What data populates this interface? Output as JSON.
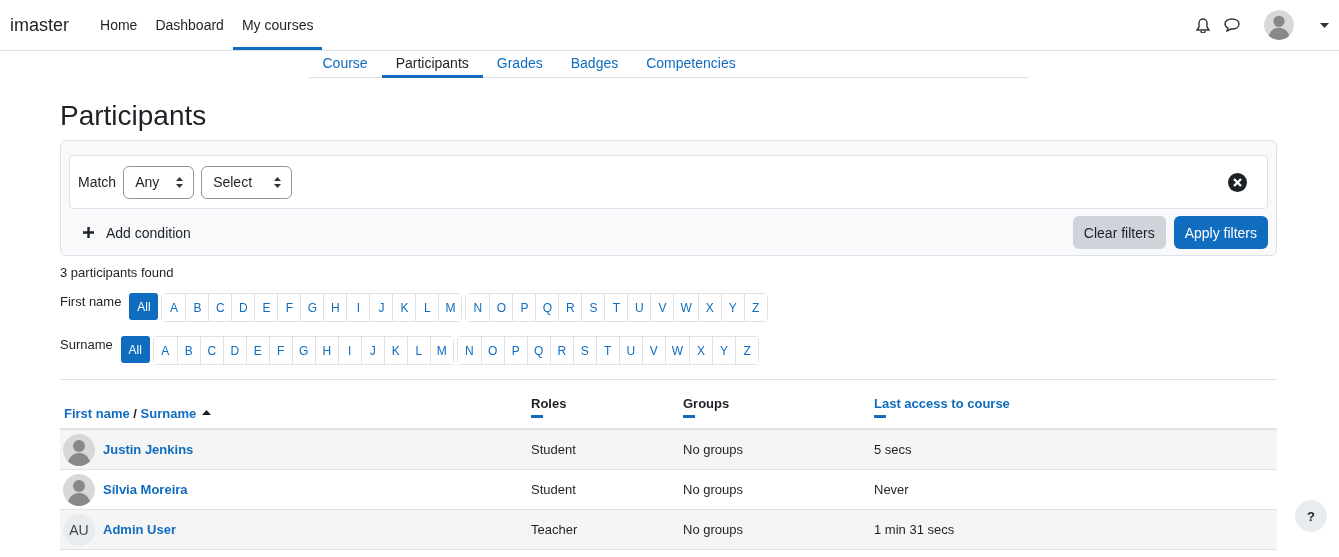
{
  "navbar": {
    "brand": "imaster",
    "links": [
      {
        "label": "Home",
        "selected": false
      },
      {
        "label": "Dashboard",
        "selected": false
      },
      {
        "label": "My courses",
        "selected": true
      }
    ]
  },
  "course_tabs": [
    {
      "label": "Course",
      "selected": false
    },
    {
      "label": "Participants",
      "selected": true
    },
    {
      "label": "Grades",
      "selected": false
    },
    {
      "label": "Badges",
      "selected": false
    },
    {
      "label": "Competencies",
      "selected": false
    }
  ],
  "page_title": "Participants",
  "filter": {
    "match_label": "Match",
    "match_value": "Any",
    "condition_value": "Select",
    "add_condition": "Add condition",
    "clear": "Clear filters",
    "apply": "Apply filters"
  },
  "found": "3 participants found",
  "initials_bars": [
    {
      "label": "First name",
      "all": "All",
      "all_selected": true,
      "groups": [
        [
          "A",
          "B",
          "C",
          "D",
          "E",
          "F",
          "G",
          "H",
          "I",
          "J",
          "K",
          "L",
          "M"
        ],
        [
          "N",
          "O",
          "P",
          "Q",
          "R",
          "S",
          "T",
          "U",
          "V",
          "W",
          "X",
          "Y",
          "Z"
        ]
      ]
    },
    {
      "label": "Surname",
      "all": "All",
      "all_selected": true,
      "groups": [
        [
          "A",
          "B",
          "C",
          "D",
          "E",
          "F",
          "G",
          "H",
          "I",
          "J",
          "K",
          "L",
          "M"
        ],
        [
          "N",
          "O",
          "P",
          "Q",
          "R",
          "S",
          "T",
          "U",
          "V",
          "W",
          "X",
          "Y",
          "Z"
        ]
      ]
    }
  ],
  "table": {
    "name_header": {
      "first": "First name",
      "separator": " / ",
      "second": "Surname",
      "sorted_ascending": true
    },
    "columns": [
      {
        "label": "Roles",
        "sortable": false
      },
      {
        "label": "Groups",
        "sortable": false
      },
      {
        "label": "Last access to course",
        "sortable": true
      }
    ],
    "rows": [
      {
        "name": "Justin Jenkins",
        "role": "Student",
        "groups": "No groups",
        "last_access": "5 secs"
      },
      {
        "name": "Sílvia Moreira",
        "role": "Student",
        "groups": "No groups",
        "last_access": "Never"
      },
      {
        "name": "Admin User",
        "initials": "AU",
        "role": "Teacher",
        "groups": "No groups",
        "last_access": "1 min 31 secs"
      }
    ]
  },
  "help": "?"
}
